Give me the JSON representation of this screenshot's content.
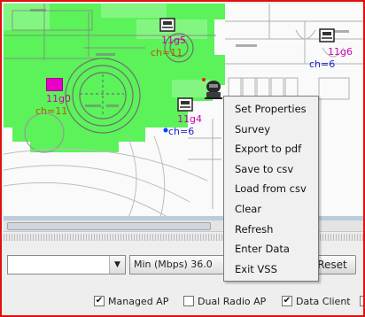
{
  "map": {
    "access_points": [
      {
        "name": "11g5",
        "channel": "ch=11",
        "name_color": "#d000b0",
        "channel_color": "#b85a00"
      },
      {
        "name": "11g6",
        "channel": "ch=6",
        "name_color": "#d000b0",
        "channel_color": "#1a22cc"
      },
      {
        "name": "11g0",
        "channel": "ch=11",
        "name_color": "#d000b0",
        "channel_color": "#b85a00"
      },
      {
        "name": "11g4",
        "channel": "ch=6",
        "name_color": "#d000b0",
        "channel_color": "#1a22cc"
      }
    ],
    "coverage_color": "#5cf25a"
  },
  "context_menu": {
    "items": [
      "Set Properties",
      "Survey",
      "Export to pdf",
      "Save to csv",
      "Load from csv",
      "Clear",
      "Refresh",
      "Enter Data",
      "Exit VSS"
    ]
  },
  "controls": {
    "rate_combo_value": "Min (Mbps) 36.0",
    "reset_label": "Reset"
  },
  "filters": {
    "managed_ap": {
      "label": "Managed AP",
      "checked": true
    },
    "dual_radio_ap": {
      "label": "Dual Radio AP",
      "checked": false
    },
    "data_client": {
      "label": "Data Client",
      "checked": true
    }
  },
  "colors": {
    "frame_border": "#e01010"
  }
}
